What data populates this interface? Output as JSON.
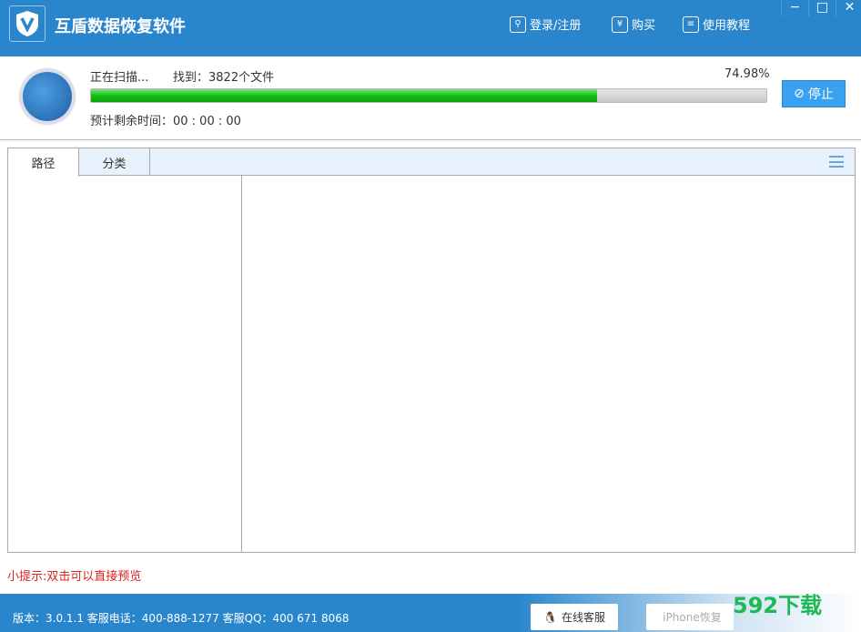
{
  "app": {
    "title": "互盾数据恢复软件",
    "logo_icon": "shield-v-icon"
  },
  "header": {
    "login": "登录/注册",
    "buy": "购买",
    "tutorial": "使用教程",
    "buy_icon": "¥"
  },
  "scan": {
    "status": "正在扫描...",
    "found": "找到：3822个文件",
    "percent_text": "74.98%",
    "progress": 74.98,
    "remaining": "预计剩余时间：00 : 00 : 00",
    "stop_label": "停止"
  },
  "tabs": [
    {
      "label": "路径"
    },
    {
      "label": "分类"
    }
  ],
  "tip": "小提示:双击可以直接预览",
  "footer": {
    "version": "版本：3.0.1.1  客服电话：400-888-1277   客服QQ：400 671 8068",
    "online_service": "在线客服",
    "iphone_recovery": "iPhone恢复"
  },
  "watermark": "592下载",
  "colors": {
    "accent": "#2a86cc",
    "progress": "#12c012",
    "tip": "#d22222"
  }
}
